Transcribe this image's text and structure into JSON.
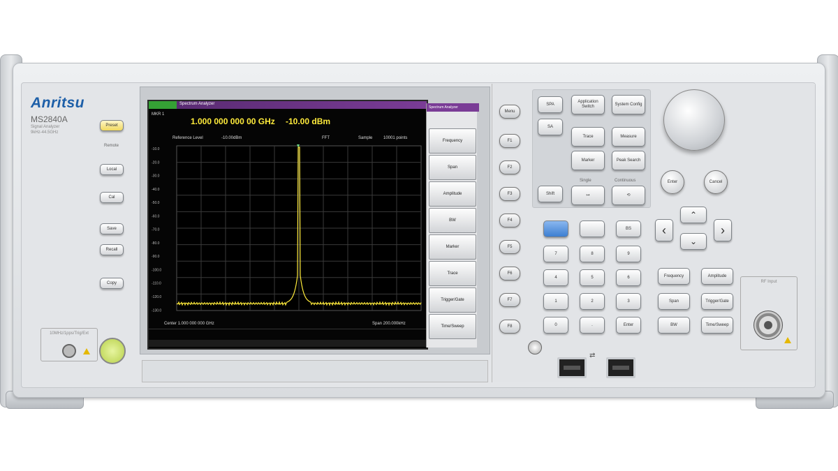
{
  "brand": "Anritsu",
  "model": "MS2840A",
  "subtitle": "Signal Analyzer",
  "subtitle2": "9kHz-44.5GHz",
  "screen": {
    "app_title": "Spectrum Analyzer",
    "freq_label": "MKR 1",
    "marker_freq": "1.000 000 000 00 GHz",
    "marker_level": "-10.00 dBm",
    "ref_level_label": "Reference Level",
    "ref_level_value": "-10.00dBm",
    "detector": "FFT",
    "sample": "Sample",
    "points": "10001 points",
    "center": "Center 1.000 000 000 GHz",
    "span": "Span 200.000kHz",
    "y_ticks": [
      "-10.0",
      "-20.0",
      "-30.0",
      "-40.0",
      "-50.0",
      "-60.0",
      "-70.0",
      "-80.0",
      "-90.0",
      "-100.0",
      "-110.0",
      "-120.0",
      "-130.0"
    ],
    "softkeys": [
      "Frequency",
      "Span",
      "Amplitude",
      "BW",
      "Marker",
      "Trace",
      "Trigger/Gate",
      "Time/Sweep"
    ],
    "softkey_header": "Spectrum Analyzer"
  },
  "left_panel": {
    "preset": "Preset",
    "remote": "Remote",
    "local": "Local",
    "cal": "Cal",
    "save": "Save",
    "recall": "Recall",
    "copy": "Copy",
    "power": "Power",
    "connector_label": "10MHz/1pps/Trig/Ext"
  },
  "fkeys": [
    "Menu",
    "F1",
    "F2",
    "F3",
    "F4",
    "F5",
    "F6",
    "F7",
    "F8"
  ],
  "function_keys": {
    "top": [
      "SPA",
      "SA"
    ],
    "app_switch": "Application Switch",
    "system_config": "System Config",
    "trace": "Trace",
    "measure": "Measure",
    "marker": "Marker",
    "peak_search": "Peak Search",
    "shift": "Shift",
    "single": "Single",
    "continuous": "Continuous",
    "enter": "Enter",
    "cancel": "Cancel",
    "bs": "BS",
    "numeric": [
      "7",
      "8",
      "9",
      "4",
      "5",
      "6",
      "1",
      "2",
      "3",
      "0",
      ".",
      "Enter"
    ],
    "right_menu": [
      "Frequency",
      "Amplitude",
      "Span",
      "Trigger/Gate",
      "BW",
      "Time/Sweep"
    ],
    "rf_input": "RF Input"
  },
  "colors": {
    "brand": "#1d5fa8",
    "trace": "#ffeb3b",
    "titlebar": "#7a3c96"
  }
}
